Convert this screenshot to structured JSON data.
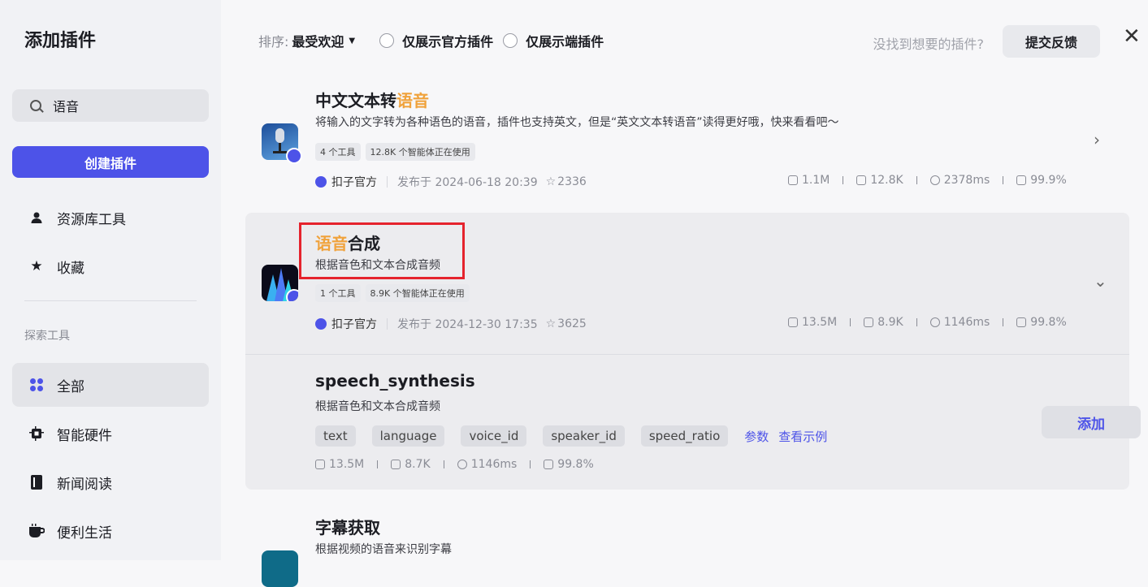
{
  "sidebar": {
    "title": "添加插件",
    "search_value": "语音",
    "create_label": "创建插件",
    "items_top": [
      {
        "label": "资源库工具",
        "icon": "user-icon"
      },
      {
        "label": "收藏",
        "icon": "star-icon"
      }
    ],
    "section_label": "探索工具",
    "items_explore": [
      {
        "label": "全部",
        "icon": "grid-icon"
      },
      {
        "label": "智能硬件",
        "icon": "chip-icon"
      },
      {
        "label": "新闻阅读",
        "icon": "book-icon"
      },
      {
        "label": "便利生活",
        "icon": "cup-icon"
      }
    ]
  },
  "toolbar": {
    "sort_label": "排序:",
    "sort_value": "最受欢迎",
    "filter_official": "仅展示官方插件",
    "filter_client": "仅展示端插件",
    "not_found": "没找到想要的插件?",
    "feedback": "提交反馈"
  },
  "plugins": [
    {
      "name_prefix": "中文文本转",
      "name_hl": "语音",
      "name_suffix": "",
      "desc": "将输入的文字转为各种语色的语音，插件也支持英文，但是“英文文本转语音”读得更好哦，快来看看吧～",
      "tag_tools": "4 个工具",
      "tag_users": "12.8K 个智能体正在使用",
      "author": "扣子官方",
      "published": "发布于 2024-06-18 20:39",
      "stars": "2336",
      "calls": "1.1M",
      "bots": "12.8K",
      "latency": "2378ms",
      "success": "99.9%"
    },
    {
      "name_prefix": "",
      "name_hl": "语音",
      "name_suffix": "合成",
      "desc": "根据音色和文本合成音频",
      "tag_tools": "1 个工具",
      "tag_users": "8.9K 个智能体正在使用",
      "author": "扣子官方",
      "published": "发布于 2024-12-30 17:35",
      "stars": "3625",
      "calls": "13.5M",
      "bots": "8.9K",
      "latency": "1146ms",
      "success": "99.8%"
    },
    {
      "name": "字幕获取",
      "desc": "根据视频的语音来识别字幕"
    }
  ],
  "tool": {
    "name": "speech_synthesis",
    "desc": "根据音色和文本合成音频",
    "params": [
      "text",
      "language",
      "voice_id",
      "speaker_id",
      "speed_ratio"
    ],
    "link_params": "参数",
    "link_example": "查看示例",
    "calls": "13.5M",
    "bots": "8.7K",
    "latency": "1146ms",
    "success": "99.8%",
    "add_label": "添加"
  },
  "colors": {
    "accent": "#4d53e8",
    "highlight": "#f0a23b",
    "annotation": "#e5232d"
  }
}
